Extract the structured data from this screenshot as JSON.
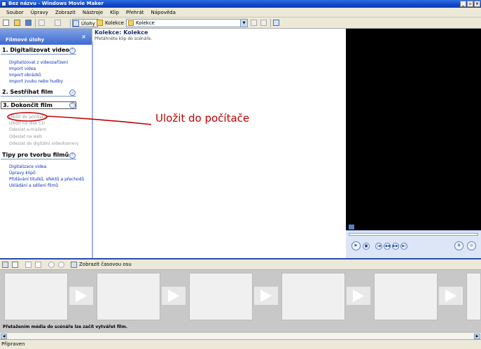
{
  "window": {
    "title": "Bez názvu - Windows Movie Maker",
    "controls": [
      "_",
      "▫",
      "×"
    ]
  },
  "menubar": [
    "Soubor",
    "Úpravy",
    "Zobrazit",
    "Nástroje",
    "Klip",
    "Přehrát",
    "Nápověda"
  ],
  "toolbar": {
    "tasks_label": "Úlohy",
    "collections_label": "Kolekce",
    "collection_combo_value": "Kolekce",
    "icons": [
      "new-project-icon",
      "open-icon",
      "save-icon",
      "undo-icon",
      "redo-icon",
      "folder-up-icon",
      "new-folder-icon",
      "views-icon"
    ]
  },
  "taskpane": {
    "header": "Filmové úlohy",
    "close": "×",
    "sections": [
      {
        "title": "1. Digitalizovat video",
        "toggle": "⌃",
        "links": [
          "Digitalizovat z videozařízení",
          "Import videa",
          "Import obrázků",
          "Import zvuku nebo hudby"
        ]
      },
      {
        "title": "2. Sestříhat film",
        "toggle": "⌄",
        "links": []
      },
      {
        "title": "3. Dokončit film",
        "toggle": "⌃",
        "links": [
          "Uložit do počítače",
          "Uložit na disk CD",
          "Odeslat e-mailem",
          "Odeslat na web",
          "Odeslat do digitální videokamery"
        ]
      },
      {
        "title": "Tipy pro tvorbu filmů",
        "toggle": "⌃",
        "links": [
          "Digitalizace videa",
          "Úpravy klipů",
          "Přidávání titulků, efektů a přechodů",
          "Ukládání a sdílení filmů"
        ]
      }
    ]
  },
  "collection": {
    "title": "Kolekce: Kolekce",
    "subtitle": "Přetáhněte klip do scénáře."
  },
  "preview": {
    "buttons": [
      "▶",
      "■",
      "|◀",
      "◀◀",
      "▶▶",
      "▶|",
      "⧉",
      "◎"
    ]
  },
  "annotation": "Uložit do počítače",
  "storyboard": {
    "show_timeline_label": "Zobrazit časovou osu",
    "hint": "Přetažením média do scénáře lze začít vytvářet film."
  },
  "statusbar": {
    "text": "Připraven"
  },
  "colors": {
    "link": "#0a2fb8",
    "annotation": "#c00000",
    "header_blue": "#3f6ad1"
  }
}
